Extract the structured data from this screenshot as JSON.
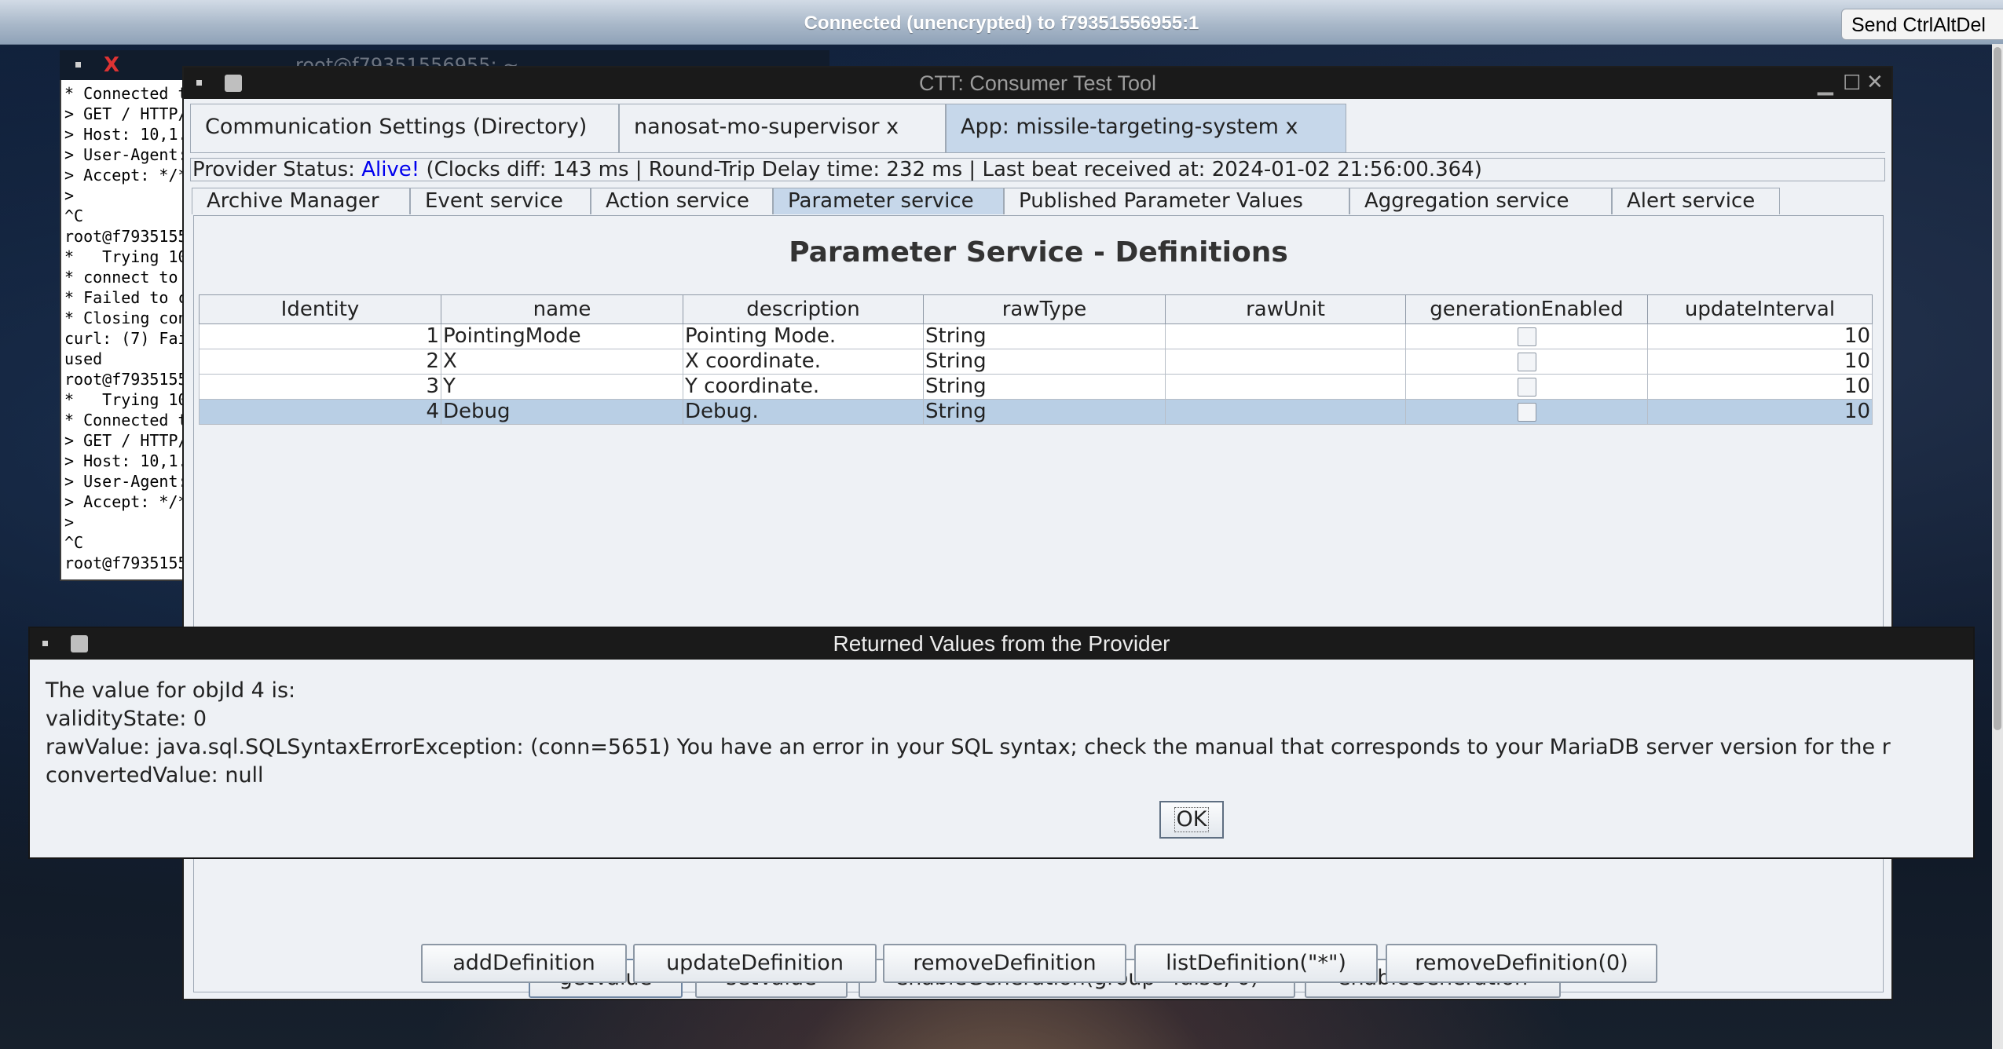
{
  "vnc": {
    "status": "Connected (unencrypted) to f79351556955:1",
    "send_ctrl_alt_del": "Send CtrlAltDel"
  },
  "terminal": {
    "title": "root@f79351556955: ~",
    "lines": [
      "* Connected t",
      "> GET / HTTP/",
      "> Host: 10,1.",
      "> User-Agent:",
      "> Accept: */*",
      ">",
      "^C",
      "root@f7935155",
      "*   Trying 10",
      "* connect to",
      "* Failed to c",
      "* Closing con",
      "curl: (7) Fai",
      "used",
      "root@f7935155",
      "*   Trying 10",
      "* Connected t",
      "> GET / HTTP/",
      "> Host: 10,1.",
      "> User-Agent:",
      "> Accept: */*",
      ">",
      "^C",
      "root@f7935155"
    ]
  },
  "ctt": {
    "title": "CTT: Consumer Test Tool",
    "top_tabs": [
      {
        "label": "Communication Settings (Directory)"
      },
      {
        "label": "nanosat-mo-supervisor x"
      },
      {
        "label": "App: missile-targeting-system x"
      }
    ],
    "status": {
      "prefix": "Provider Status: ",
      "alive": "Alive!",
      "details": " (Clocks diff: 143 ms | Round-Trip Delay time: 232 ms | Last beat received at: 2024-01-02 21:56:00.364)"
    },
    "sub_tabs": [
      {
        "label": "Archive Manager"
      },
      {
        "label": "Event service"
      },
      {
        "label": "Action service"
      },
      {
        "label": "Parameter service"
      },
      {
        "label": "Published Parameter Values"
      },
      {
        "label": "Aggregation service"
      },
      {
        "label": "Alert service"
      }
    ],
    "panel_heading": "Parameter Service - Definitions",
    "table": {
      "columns": [
        "Identity",
        "name",
        "description",
        "rawType",
        "rawUnit",
        "generationEnabled",
        "updateInterval"
      ],
      "rows": [
        {
          "identity": "1",
          "name": "PointingMode",
          "description": "Pointing Mode.",
          "rawType": "String",
          "rawUnit": "",
          "generationEnabled": false,
          "updateInterval": "10"
        },
        {
          "identity": "2",
          "name": "X",
          "description": "X coordinate.",
          "rawType": "String",
          "rawUnit": "",
          "generationEnabled": false,
          "updateInterval": "10"
        },
        {
          "identity": "3",
          "name": "Y",
          "description": "Y coordinate.",
          "rawType": "String",
          "rawUnit": "",
          "generationEnabled": false,
          "updateInterval": "10"
        },
        {
          "identity": "4",
          "name": "Debug",
          "description": "Debug.",
          "rawType": "String",
          "rawUnit": "",
          "generationEnabled": false,
          "updateInterval": "10"
        }
      ]
    },
    "buttons_row1": [
      "getValue",
      "setValue",
      "enableGeneration(group=false, 0)",
      "enableGeneration"
    ],
    "buttons_row2": [
      "addDefinition",
      "updateDefinition",
      "removeDefinition",
      "listDefinition(\"*\")",
      "removeDefinition(0)"
    ]
  },
  "dialog": {
    "title": "Returned Values from the Provider",
    "lines": [
      "The value for objId 4 is:",
      "validityState: 0",
      "rawValue: java.sql.SQLSyntaxErrorException: (conn=5651) You have an error in your SQL syntax; check the manual that corresponds to your MariaDB server version for the r",
      "convertedValue: null"
    ],
    "ok_label": "OK"
  }
}
